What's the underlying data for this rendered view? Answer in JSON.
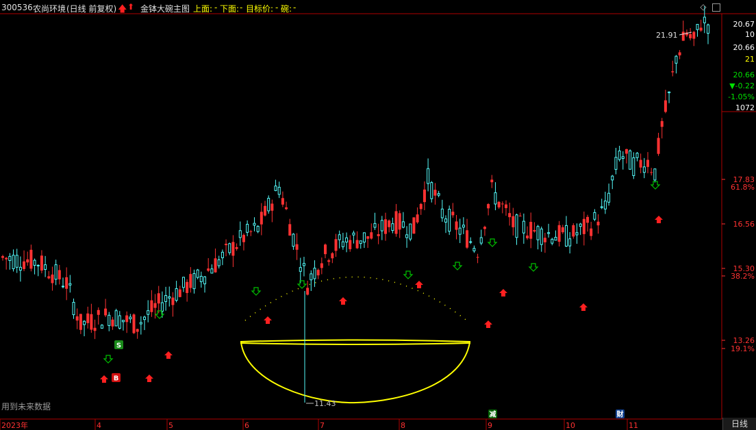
{
  "header": {
    "code": "300536",
    "name": "农尚环境",
    "period": "(日线 前复权)",
    "indicator": "金钵大碗主图",
    "upper_label": "上面:",
    "upper_value": "-",
    "lower_label": "下面:",
    "lower_value": "-",
    "target_label": "目标价:",
    "target_value": "-",
    "bowl_label": "碗:",
    "bowl_value": "-"
  },
  "right_axis": {
    "price_labels": [
      "20.67",
      "10",
      "20.66",
      "21",
      "20.66",
      "▼-0.22",
      "-1.05%",
      "1072",
      "17.83",
      "61.8%",
      "16.56",
      "15.30",
      "38.2%",
      "13.26",
      "19.1%"
    ],
    "colors": [
      "#ffffff",
      "#ffffff",
      "#ffffff",
      "#ffff00",
      "#00e000",
      "#00e000",
      "#00e000",
      "#ffffff",
      "#ff3232",
      "#ff3232",
      "#ff3232",
      "#ff3232",
      "#ff3232",
      "#ff3232",
      "#ff3232"
    ]
  },
  "x_axis": {
    "labels": [
      "2023年",
      "4",
      "5",
      "6",
      "7",
      "8",
      "9",
      "10",
      "11"
    ]
  },
  "annotations": {
    "high": "21.91",
    "low": "11.43",
    "future_note": "用到未来数据",
    "sell": "S",
    "buy": "B",
    "reduce": "减",
    "finance": "财"
  },
  "bottom_tab": "日线",
  "colors": {
    "up": "#ff3232",
    "down": "#54fcfc",
    "bowl": "#ffff00",
    "signal_down": "#00c000",
    "signal_up": "#ff2020"
  },
  "chart_data": {
    "type": "candlestick",
    "title": "",
    "y_scale": "log",
    "ylim": [
      10.6,
      21.0
    ],
    "fib_levels": [
      {
        "price": 17.83,
        "ratio": "61.8%"
      },
      {
        "price": 15.3,
        "ratio": "38.2%"
      },
      {
        "price": 13.26,
        "ratio": "19.1%"
      }
    ],
    "high_price": 21.91,
    "low_price": 11.43
  }
}
